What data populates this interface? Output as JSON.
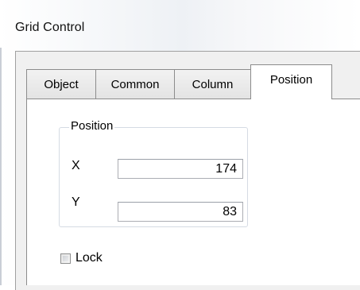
{
  "window": {
    "title": "Grid Control"
  },
  "tabs": [
    {
      "label": "Object",
      "active": false
    },
    {
      "label": "Common",
      "active": false
    },
    {
      "label": "Column",
      "active": false
    },
    {
      "label": "Position",
      "active": true
    }
  ],
  "position_group": {
    "legend": "Position",
    "x_label": "X",
    "x_value": "174",
    "y_label": "Y",
    "y_value": "83"
  },
  "lock": {
    "label": "Lock",
    "checked": false
  },
  "colors": {
    "tab_border": "#8c8c8c",
    "group_border": "#d5dbe3",
    "input_border": "#abadb3",
    "dialog_bg": "#f0f0f0"
  }
}
